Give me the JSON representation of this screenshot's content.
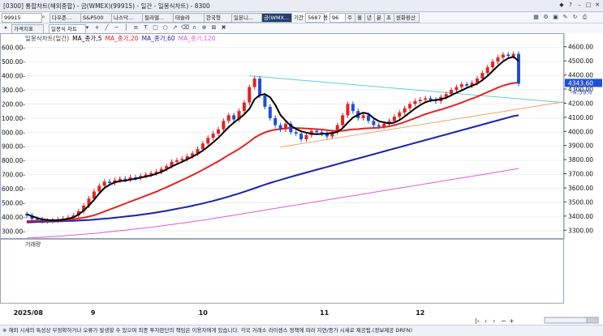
{
  "window": {
    "title": "[0300] 통합차트(해외종합) - 금(WMEX)(99915) - 일간 - 일봉식차트) - 8300"
  },
  "toolbar": {
    "code": "99915",
    "market_1": "다우존...",
    "market_2": "S&P500",
    "market_3": "나스닥...",
    "market_4": "필라델...",
    "market_5": "테슬라",
    "market_6": "한국형",
    "market_7": "일본니...",
    "selected": "금(WMX...",
    "period_label": "기간",
    "period_value": "5687",
    "count_label": "봉",
    "count_value": "96",
    "interval_1": "주",
    "interval_2": "월",
    "interval_3": "년",
    "interval_4": "분",
    "interval_5": "초",
    "fx_button": "원화환산"
  },
  "toolbar2": {
    "indicator_button": "가격지표",
    "chart_type": "일봉식 차트"
  },
  "chart_data": {
    "type": "candlestick",
    "legend": [
      {
        "name": "일봉식차트(일간)",
        "color": "#444444"
      },
      {
        "name": "MA_종가,5",
        "color": "#000000"
      },
      {
        "name": "MA_종가,20",
        "color": "#e52222"
      },
      {
        "name": "MA_종가,60",
        "color": "#1a22b0"
      },
      {
        "name": "MA_종가,120",
        "color": "#e05ad8"
      }
    ],
    "y_left": {
      "labels": [
        "600.00-",
        "500.00-",
        "400.00-",
        "300.00-",
        "200.00-",
        "100.00-",
        "000.00-",
        "900.00-",
        "800.00-",
        "700.00-",
        "600.00-",
        "500.00-",
        "400.00-",
        "300.00-"
      ]
    },
    "y_right": {
      "min": 3250,
      "max": 4650,
      "ticks": [
        4600,
        4500,
        4400,
        4300,
        4200,
        4100,
        4000,
        3900,
        3800,
        3700,
        3600,
        3500,
        3400,
        3300
      ],
      "tick_labels": [
        "4600.00",
        "4500.00",
        "4400.00",
        "4300.00",
        "4200.00",
        "4100.00",
        "4000.00",
        "3900.00",
        "3800.00",
        "3700.00",
        "3600.00",
        "3500.00",
        "3400.00",
        "3300.00"
      ]
    },
    "x_labels": [
      "2025/08",
      "9",
      "10",
      "11",
      "12"
    ],
    "last_price": "4343.60",
    "last_change": "-4.59%",
    "up_color": "#e52222",
    "down_color": "#1f4fd8",
    "closes": [
      3410,
      3385,
      3380,
      3370,
      3372,
      3375,
      3380,
      3388,
      3395,
      3410,
      3440,
      3480,
      3530,
      3580,
      3620,
      3650,
      3640,
      3660,
      3670,
      3665,
      3680,
      3675,
      3690,
      3700,
      3710,
      3720,
      3740,
      3760,
      3790,
      3800,
      3810,
      3830,
      3850,
      3880,
      3920,
      3960,
      3990,
      4020,
      4080,
      4120,
      4090,
      4150,
      4210,
      4320,
      4380,
      4260,
      4180,
      4100,
      4050,
      4020,
      4060,
      4000,
      3990,
      3950,
      3980,
      4010,
      4000,
      3990,
      3970,
      4000,
      4050,
      4120,
      4200,
      4150,
      4100,
      4120,
      4080,
      4050,
      4040,
      4060,
      4080,
      4110,
      4140,
      4170,
      4200,
      4220,
      4230,
      4240,
      4230,
      4220,
      4250,
      4270,
      4300,
      4320,
      4340,
      4330,
      4350,
      4380,
      4420,
      4460,
      4500,
      4530,
      4550,
      4540,
      4555,
      4343.6
    ],
    "ma5": [
      3420,
      3405,
      3392,
      3383,
      3378,
      3376,
      3377,
      3381,
      3387,
      3396,
      3417,
      3445,
      3480,
      3521,
      3566,
      3605,
      3628,
      3644,
      3654,
      3657,
      3664,
      3670,
      3678,
      3686,
      3694,
      3705,
      3719,
      3736,
      3757,
      3774,
      3790,
      3808,
      3826,
      3846,
      3870,
      3898,
      3928,
      3960,
      3998,
      4036,
      4068,
      4096,
      4126,
      4166,
      4234,
      4262,
      4270,
      4248,
      4194,
      4122,
      4082,
      4046,
      4024,
      4006,
      3997,
      3989,
      3986,
      3988,
      3990,
      3994,
      4002,
      4028,
      4068,
      4104,
      4124,
      4138,
      4130,
      4100,
      4078,
      4070,
      4062,
      4068,
      4086,
      4112,
      4140,
      4168,
      4192,
      4212,
      4224,
      4228,
      4234,
      4244,
      4262,
      4280,
      4296,
      4314,
      4328,
      4344,
      4368,
      4398,
      4434,
      4470,
      4502,
      4524,
      4535,
      4504
    ],
    "ma20": [
      3370,
      3372,
      3373,
      3374,
      3375,
      3376,
      3377,
      3379,
      3381,
      3384,
      3388,
      3394,
      3402,
      3412,
      3424,
      3438,
      3452,
      3466,
      3480,
      3494,
      3508,
      3522,
      3536,
      3550,
      3564,
      3578,
      3594,
      3610,
      3627,
      3644,
      3661,
      3678,
      3696,
      3714,
      3733,
      3753,
      3773,
      3794,
      3816,
      3839,
      3860,
      3882,
      3906,
      3933,
      3961,
      3982,
      3998,
      4010,
      4018,
      4022,
      4028,
      4030,
      4030,
      4028,
      4026,
      4024,
      4022,
      4019,
      4014,
      4010,
      4008,
      4010,
      4016,
      4020,
      4022,
      4026,
      4028,
      4030,
      4032,
      4036,
      4042,
      4050,
      4060,
      4072,
      4086,
      4100,
      4114,
      4128,
      4140,
      4150,
      4160,
      4172,
      4184,
      4196,
      4210,
      4224,
      4238,
      4252,
      4268,
      4284,
      4300,
      4316,
      4330,
      4340,
      4348,
      4352
    ],
    "ma60": [
      3360,
      3362,
      3364,
      3365,
      3366,
      3367,
      3368,
      3370,
      3371,
      3372,
      3374,
      3376,
      3378,
      3381,
      3384,
      3387,
      3390,
      3394,
      3398,
      3402,
      3406,
      3410,
      3415,
      3420,
      3425,
      3431,
      3437,
      3443,
      3450,
      3457,
      3464,
      3471,
      3479,
      3487,
      3495,
      3504,
      3513,
      3523,
      3533,
      3544,
      3555,
      3566,
      3578,
      3590,
      3603,
      3616,
      3628,
      3640,
      3651,
      3662,
      3673,
      3684,
      3694,
      3704,
      3714,
      3724,
      3734,
      3744,
      3754,
      3764,
      3774,
      3784,
      3794,
      3804,
      3814,
      3824,
      3834,
      3844,
      3854,
      3864,
      3874,
      3884,
      3894,
      3904,
      3914,
      3924,
      3934,
      3944,
      3954,
      3964,
      3974,
      3984,
      3994,
      4004,
      4014,
      4024,
      4034,
      4044,
      4054,
      4064,
      4074,
      4084,
      4094,
      4104,
      4114,
      4120
    ],
    "ma120": [
      3250,
      3252,
      3254,
      3256,
      3258,
      3260,
      3262,
      3265,
      3268,
      3271,
      3274,
      3277,
      3280,
      3283,
      3286,
      3290,
      3294,
      3298,
      3302,
      3306,
      3310,
      3314,
      3318,
      3322,
      3326,
      3331,
      3336,
      3341,
      3346,
      3351,
      3356,
      3361,
      3366,
      3371,
      3376,
      3382,
      3388,
      3394,
      3400,
      3406,
      3412,
      3418,
      3424,
      3430,
      3436,
      3442,
      3448,
      3454,
      3460,
      3466,
      3472,
      3478,
      3484,
      3490,
      3496,
      3502,
      3508,
      3514,
      3520,
      3526,
      3532,
      3538,
      3544,
      3550,
      3556,
      3562,
      3568,
      3574,
      3580,
      3586,
      3592,
      3598,
      3604,
      3610,
      3616,
      3622,
      3628,
      3634,
      3640,
      3646,
      3652,
      3658,
      3664,
      3670,
      3676,
      3682,
      3688,
      3694,
      3700,
      3706,
      3712,
      3718,
      3724,
      3730,
      3736,
      3742
    ]
  },
  "volume": {
    "label": "거래량"
  },
  "footer": {
    "disclaimer": "※ 해외 시세의 특성상 부정확하거나 오류가 발생할 수 있으며 최종 투자판단의 책임은 이용자에게 있습니다. 각국 거래소 라이센스 정책에 따라 지연/종가 시세로 제공됨.(정보제공 DRFN)"
  }
}
